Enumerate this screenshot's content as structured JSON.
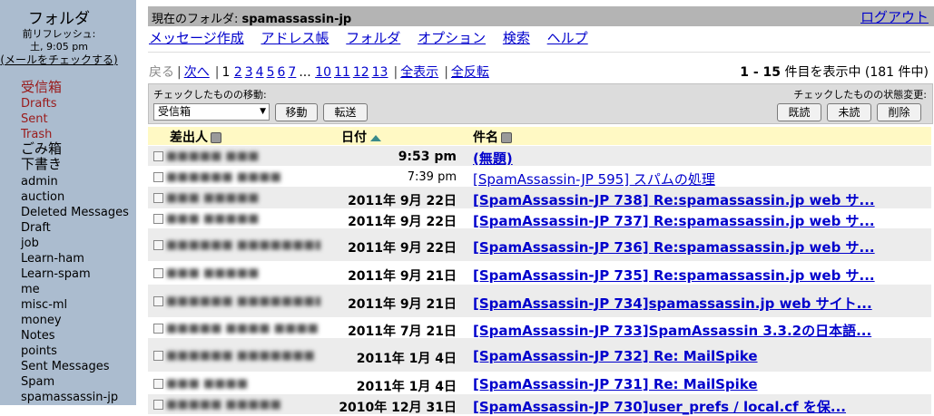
{
  "sidebar": {
    "title": "フォルダ",
    "last_refresh_label": "前リフレッシュ:",
    "last_refresh_time": "土, 9:05 pm",
    "check_mail": "(メールをチェックする)",
    "folders": [
      {
        "label": "受信箱",
        "special": true,
        "big": true
      },
      {
        "label": "Drafts",
        "special": true
      },
      {
        "label": "Sent",
        "special": true
      },
      {
        "label": "Trash",
        "special": true
      },
      {
        "label": "ごみ箱",
        "big": true
      },
      {
        "label": "下書き",
        "big": true
      },
      {
        "label": "admin"
      },
      {
        "label": "auction"
      },
      {
        "label": "Deleted Messages"
      },
      {
        "label": "Draft"
      },
      {
        "label": "job"
      },
      {
        "label": "Learn-ham"
      },
      {
        "label": "Learn-spam"
      },
      {
        "label": "me"
      },
      {
        "label": "misc-ml"
      },
      {
        "label": "money"
      },
      {
        "label": "Notes"
      },
      {
        "label": "points"
      },
      {
        "label": "Sent Messages"
      },
      {
        "label": "Spam"
      },
      {
        "label": "spamassassin-jp"
      }
    ]
  },
  "header": {
    "current_folder_label": "現在のフォルダ: ",
    "current_folder": "spamassassin-jp",
    "logout": "ログアウト"
  },
  "menu": [
    "メッセージ作成",
    "アドレス帳",
    "フォルダ",
    "オプション",
    "検索",
    "ヘルプ"
  ],
  "pager": {
    "prev": "戻る",
    "next": "次へ",
    "current_page": "1",
    "pages": [
      "2",
      "3",
      "4",
      "5",
      "6",
      "7"
    ],
    "ellipsis": "...",
    "more_pages": [
      "10",
      "11",
      "12",
      "13"
    ],
    "show_all": "全表示",
    "invert": "全反転",
    "range": "1 - 15",
    "range_suffix": " 件目を表示中 (181 件中)"
  },
  "actions": {
    "move_label": "チェックしたものの移動:",
    "move_target": "受信箱",
    "move_button": "移動",
    "forward_button": "転送",
    "state_label": "チェックしたものの状態変更:",
    "read_button": "既読",
    "unread_button": "未読",
    "delete_button": "削除"
  },
  "table": {
    "col_from": "差出人",
    "col_date": "日付",
    "col_subject": "件名",
    "rows": [
      {
        "from": "■■■■■ ■■■",
        "date": "9:53 pm",
        "subject": "(無題)",
        "unread": true
      },
      {
        "from": "■■■■■■ ■■■■",
        "date": "7:39 pm",
        "subject": "[SpamAssassin-JP 595] スパムの処理",
        "unread": false
      },
      {
        "from": "■■■ ■■■■■",
        "date": "2011年 9月 22日",
        "subject": "[SpamAssassin-JP 738] Re:spamassassin.jp web サ...",
        "unread": true
      },
      {
        "from": "■■■ ■■■■■",
        "date": "2011年 9月 22日",
        "subject": "[SpamAssassin-JP 737] Re:spamassassin.jp web サ...",
        "unread": true
      },
      {
        "from": "■■■■■■ ■■■■■■■■",
        "date": "2011年 9月 22日",
        "subject": "[SpamAssassin-JP 736] Re:spamassassin.jp web サ...",
        "unread": true
      },
      {
        "from": "■■■ ■■■■■",
        "date": "2011年 9月 21日",
        "subject": "[SpamAssassin-JP 735] Re:spamassassin.jp web サ...",
        "unread": true
      },
      {
        "from": "■■■■■■ ■■■■■■■■",
        "date": "2011年 9月 21日",
        "subject": "[SpamAssassin-JP 734]spamassassin.jp web サイト...",
        "unread": true
      },
      {
        "from": "■■■■■ ■■■■ ■■■■",
        "date": "2011年 7月 21日",
        "subject": "[SpamAssassin-JP 733]SpamAssassin 3.3.2の日本語...",
        "unread": true
      },
      {
        "from": "■■■■■■ ■■■■■■■",
        "date": "2011年 1月 4日",
        "subject": "[SpamAssassin-JP 732] Re: MailSpike",
        "unread": true
      },
      {
        "from": "■■■ ■■■■",
        "date": "2011年 1月 4日",
        "subject": "[SpamAssassin-JP 731] Re: MailSpike",
        "unread": true
      },
      {
        "from": "■■■■■ ■■■■■",
        "date": "2010年 12月 31日",
        "subject": "[SpamAssassin-JP 730]user_prefs / local.cf を保...",
        "unread": true
      }
    ]
  },
  "colors": {
    "sidebar_bg": "#abbccf",
    "link": "#0000cc",
    "special_folder": "#9a1a1a",
    "header_row": "#fff9c4"
  }
}
